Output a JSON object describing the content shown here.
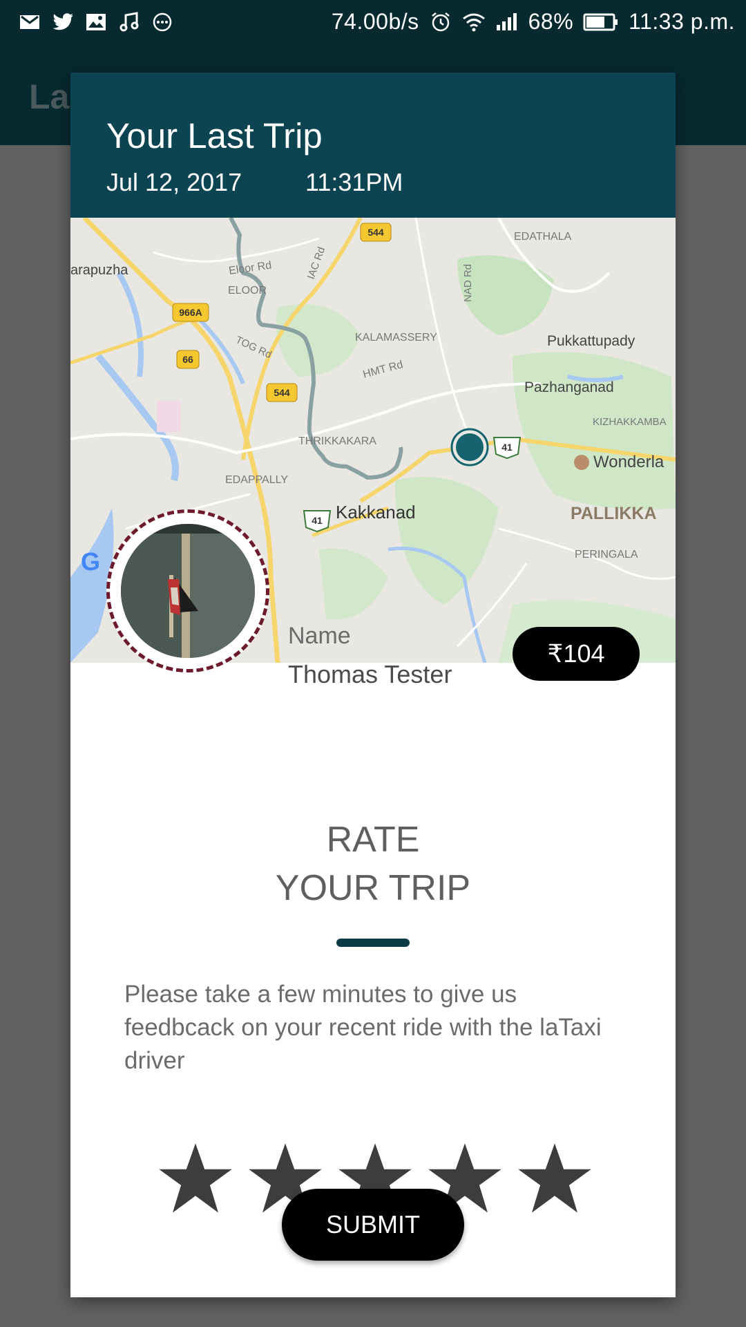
{
  "status_bar": {
    "net_speed": "74.00b/s",
    "battery": "68%",
    "time": "11:33 p.m.",
    "left_icons": [
      "gmail-icon",
      "twitter-icon",
      "gallery-icon",
      "music-icon",
      "more-notifications-icon"
    ],
    "right_icons": [
      "alarm-icon",
      "wifi-icon",
      "signal-icon",
      "battery-icon"
    ]
  },
  "app_bar": {
    "title_partial": "La"
  },
  "dialog": {
    "title": "Your Last Trip",
    "date": "Jul 12, 2017",
    "time": "11:31PM",
    "driver": {
      "name_label": "Name",
      "name": "Thomas Tester"
    },
    "fare": "₹104",
    "rate_line1": "RATE",
    "rate_line2": "YOUR TRIP",
    "feedback": "Please take a few minutes to give us feedbcack on your recent ride with the laTaxi driver",
    "rating": {
      "max": 5,
      "filled": 5,
      "color": "#3d3d3d"
    },
    "submit_label": "SUBMIT"
  },
  "map": {
    "labels": [
      "EDATHALA",
      "arapuzha",
      "Eloor Rd",
      "ELOOR",
      "IAC Rd",
      "NAD Rd",
      "KALAMASSERY",
      "Pukkattupady",
      "TOG Rd",
      "HMT Rd",
      "Pazhanganad",
      "KIZHAKKAMBA",
      "THRIKKAKARA",
      "Wonderla",
      "EDAPPALLY",
      "Kakkanad",
      "PALLIKKA",
      "PERINGALA"
    ],
    "shields": [
      "544",
      "966A",
      "66",
      "544",
      "41",
      "41"
    ],
    "logo_partial": "G"
  },
  "colors": {
    "header": "#0c4451",
    "status_bar": "#062a30",
    "overlay": "#626262",
    "route": "#8aa1a3",
    "marker": "#14636f"
  }
}
